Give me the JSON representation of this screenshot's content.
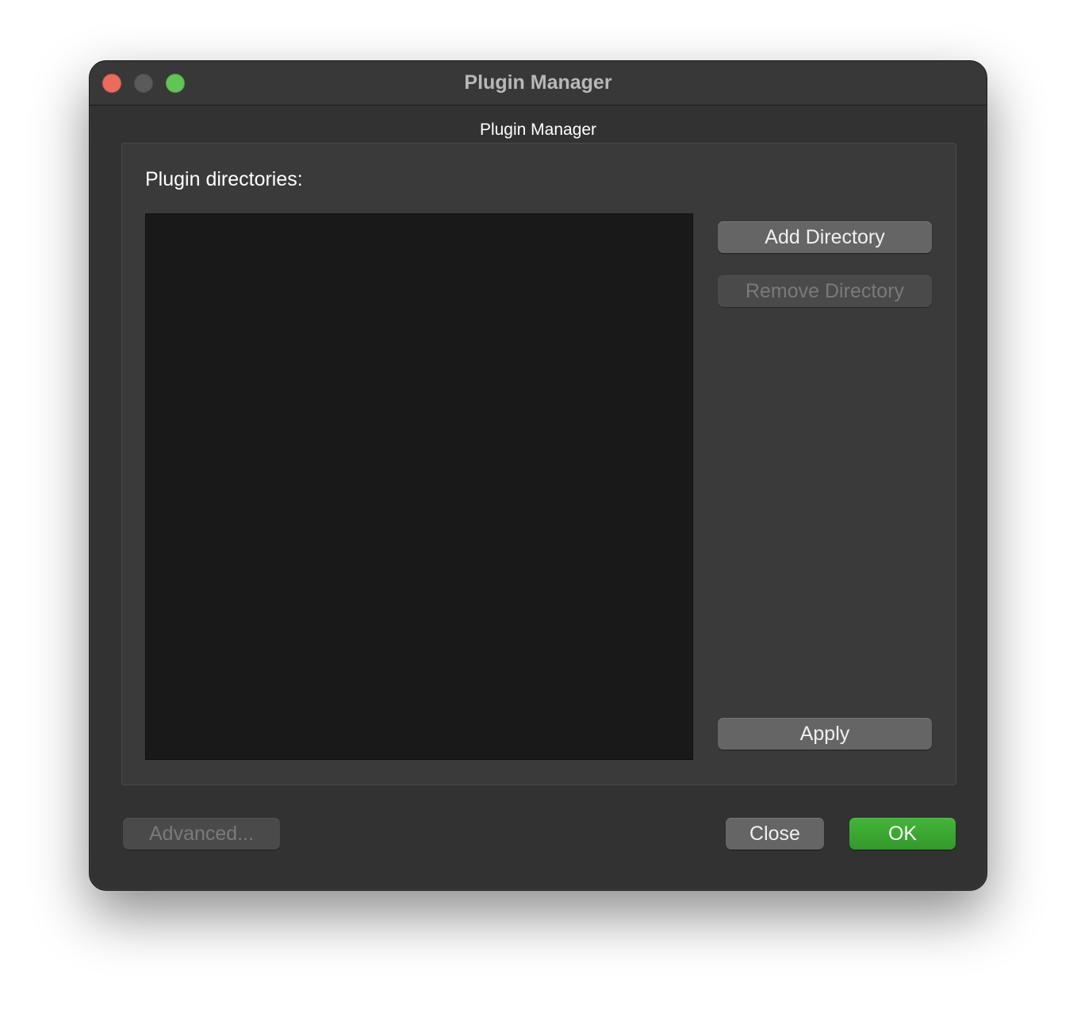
{
  "window": {
    "title": "Plugin Manager",
    "controls": {
      "close_color": "#ec6a5e",
      "minimize_color": "#5a5a5a",
      "zoom_color": "#61c454"
    }
  },
  "group": {
    "title": "Plugin Manager",
    "directories_label": "Plugin directories:",
    "directories": []
  },
  "buttons": {
    "add_directory": "Add Directory",
    "remove_directory": "Remove Directory",
    "apply": "Apply",
    "advanced": "Advanced...",
    "close": "Close",
    "ok": "OK"
  },
  "colors": {
    "accent_ok": "#3aa52f",
    "background": "#323232",
    "list_background": "#191919"
  }
}
